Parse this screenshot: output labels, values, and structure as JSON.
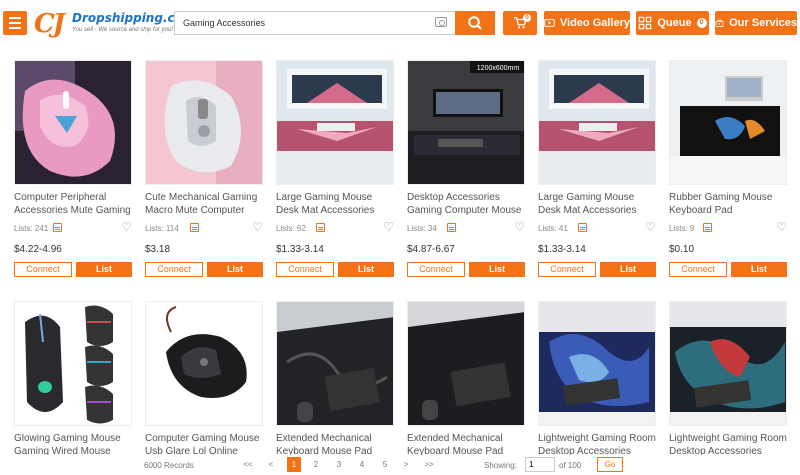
{
  "header": {
    "logo_mark": "CJ",
    "logo_name": "Dropshipping.com",
    "logo_tagline": "You sell - We source and ship for you!",
    "search_value": "Gaming Accessories",
    "cart_count": "0",
    "video_gallery_label": "Video Gallery",
    "queue_label": "Queue",
    "queue_count": "0",
    "services_label": "Our Services",
    "accent_color": "#f47216"
  },
  "products": [
    {
      "title": "Computer Peripheral Accessories Mute Gaming Mouse",
      "lists": "Lists: 241",
      "price": "$4.22-4.96",
      "connect": "Connect",
      "list": "List"
    },
    {
      "title": "Cute Mechanical Gaming Macro Mute Computer Mouse",
      "lists": "Lists: 114",
      "price": "$3.18",
      "connect": "Connect",
      "list": "List"
    },
    {
      "title": "Large Gaming Mouse Desk Mat Accessories",
      "lists": "Lists: 62",
      "price": "$1.33-3.14",
      "connect": "Connect",
      "list": "List"
    },
    {
      "title": "Desktop Accessories Gaming Computer Mouse Pad",
      "lists": "Lists: 34",
      "price": "$4.87-6.67",
      "connect": "Connect",
      "list": "List",
      "size_label": "1200x600mm"
    },
    {
      "title": "Large Gaming Mouse Desk Mat Accessories",
      "lists": "Lists: 41",
      "price": "$1.33-3.14",
      "connect": "Connect",
      "list": "List"
    },
    {
      "title": "Rubber Gaming Mouse Keyboard Pad Accessories",
      "lists": "Lists: 9",
      "price": "$0.10",
      "connect": "Connect",
      "list": "List"
    },
    {
      "title": "Glowing Gaming Mouse Gaming Wired Mouse"
    },
    {
      "title": "Computer Gaming Mouse Usb Glare Lol Online"
    },
    {
      "title": "Extended Mechanical Keyboard Mouse Pad"
    },
    {
      "title": "Extended Mechanical Keyboard Mouse Pad"
    },
    {
      "title": "Lightweight Gaming Room Desktop Accessories Mouse Pad"
    },
    {
      "title": "Lightweight Gaming Room Desktop Accessories Mouse Pad"
    }
  ],
  "pagination": {
    "records": "6000 Records",
    "first": "<<",
    "prev": "<",
    "pages": [
      "1",
      "2",
      "3",
      "4",
      "5"
    ],
    "next": ">",
    "last": ">>",
    "showing_label": "Showing:",
    "current_page": "1",
    "of_total": "of 100",
    "go_label": "Go"
  }
}
